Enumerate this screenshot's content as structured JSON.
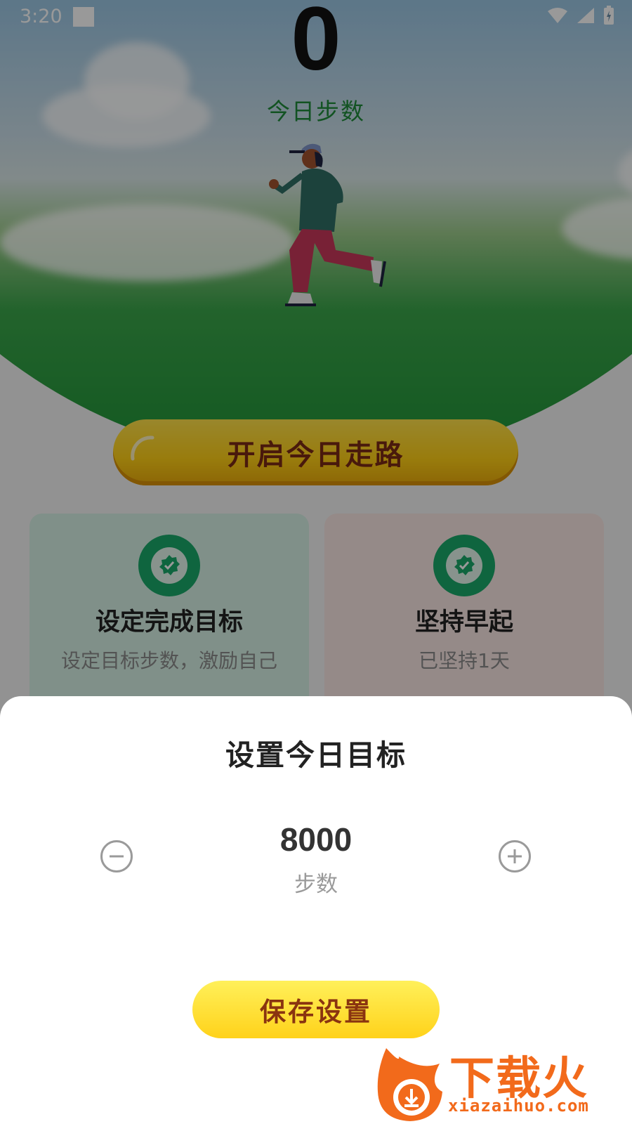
{
  "status_bar": {
    "time": "3:20"
  },
  "hero": {
    "step_count": "0",
    "step_label": "今日步数"
  },
  "start_button": {
    "label": "开启今日走路"
  },
  "cards": [
    {
      "title": "设定完成目标",
      "subtitle": "设定目标步数，激励自己"
    },
    {
      "title": "坚持早起",
      "subtitle": "已坚持1天"
    }
  ],
  "sheet": {
    "title": "设置今日目标",
    "goal_value": "8000",
    "goal_unit": "步数",
    "save_label": "保存设置"
  },
  "watermark": {
    "text": "下载火",
    "url": "xiazaihuo.com"
  },
  "colors": {
    "accent_yellow": "#ffd21a",
    "brand_green": "#1aa86a",
    "step_label_green": "#1e8a3a",
    "watermark_orange": "#f26a1b"
  },
  "icons": [
    "wifi-icon",
    "signal-icon",
    "battery-icon",
    "minus-icon",
    "plus-icon",
    "badge-check-icon",
    "runner-illustration"
  ]
}
